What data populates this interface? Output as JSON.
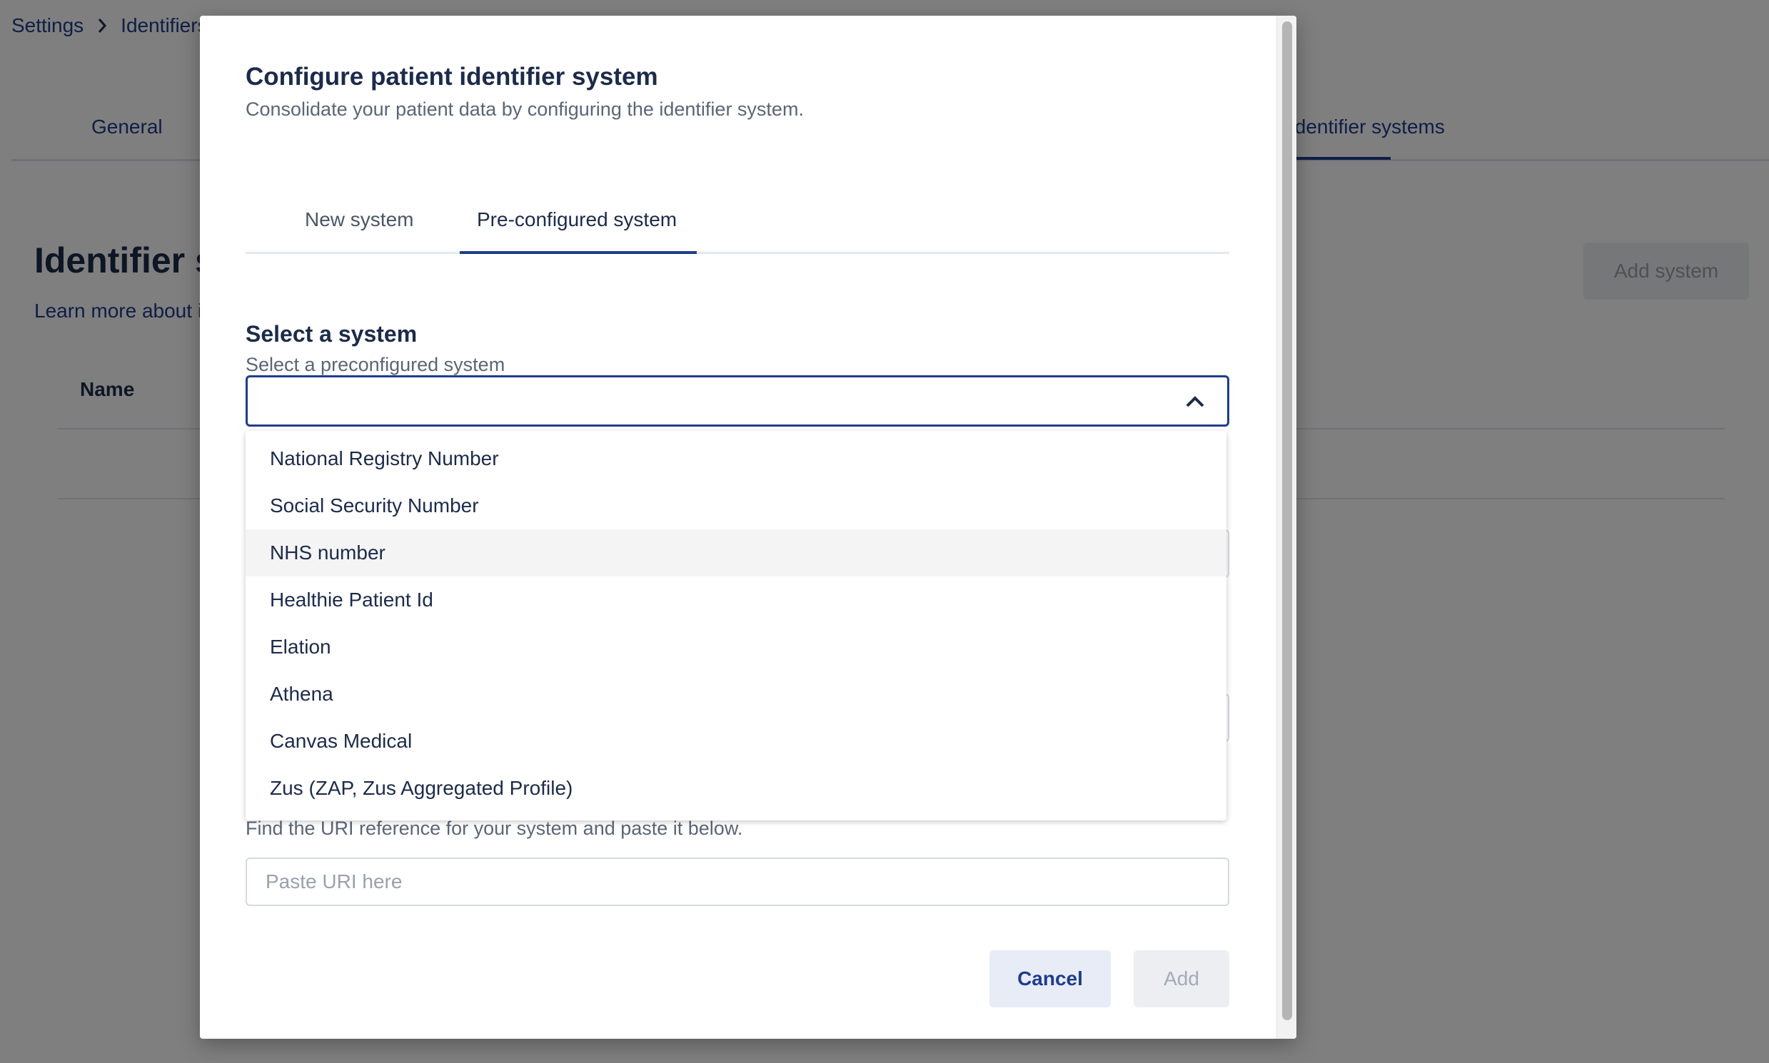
{
  "breadcrumb": {
    "root": "Settings",
    "current": "Identifiers"
  },
  "page": {
    "tabs": {
      "general": "General",
      "systems": "Identifier systems"
    },
    "title": "Identifier systems",
    "learn_more": "Learn more about identifier systems",
    "add_button": "Add system",
    "table": {
      "col_name": "Name"
    }
  },
  "modal": {
    "title": "Configure patient identifier system",
    "subtitle": "Consolidate your patient data by configuring the identifier system.",
    "tabs": {
      "new": "New system",
      "preconfigured": "Pre-configured system"
    },
    "select": {
      "label": "Select a system",
      "help": "Select a preconfigured system",
      "value": "",
      "options": [
        "National Registry Number",
        "Social Security Number",
        "NHS number",
        "Healthie Patient Id",
        "Elation",
        "Athena",
        "Canvas Medical",
        "Zus (ZAP, Zus Aggregated Profile)"
      ],
      "hovered_index": 2
    },
    "uri": {
      "help": "Find the URI reference for your system and paste it below.",
      "placeholder": "Paste URI here"
    },
    "buttons": {
      "cancel": "Cancel",
      "add": "Add"
    }
  },
  "colors": {
    "primary": "#1f3d8a",
    "text": "#1c2b4a",
    "muted": "#5b6577",
    "hover": "#f4f4f4"
  }
}
